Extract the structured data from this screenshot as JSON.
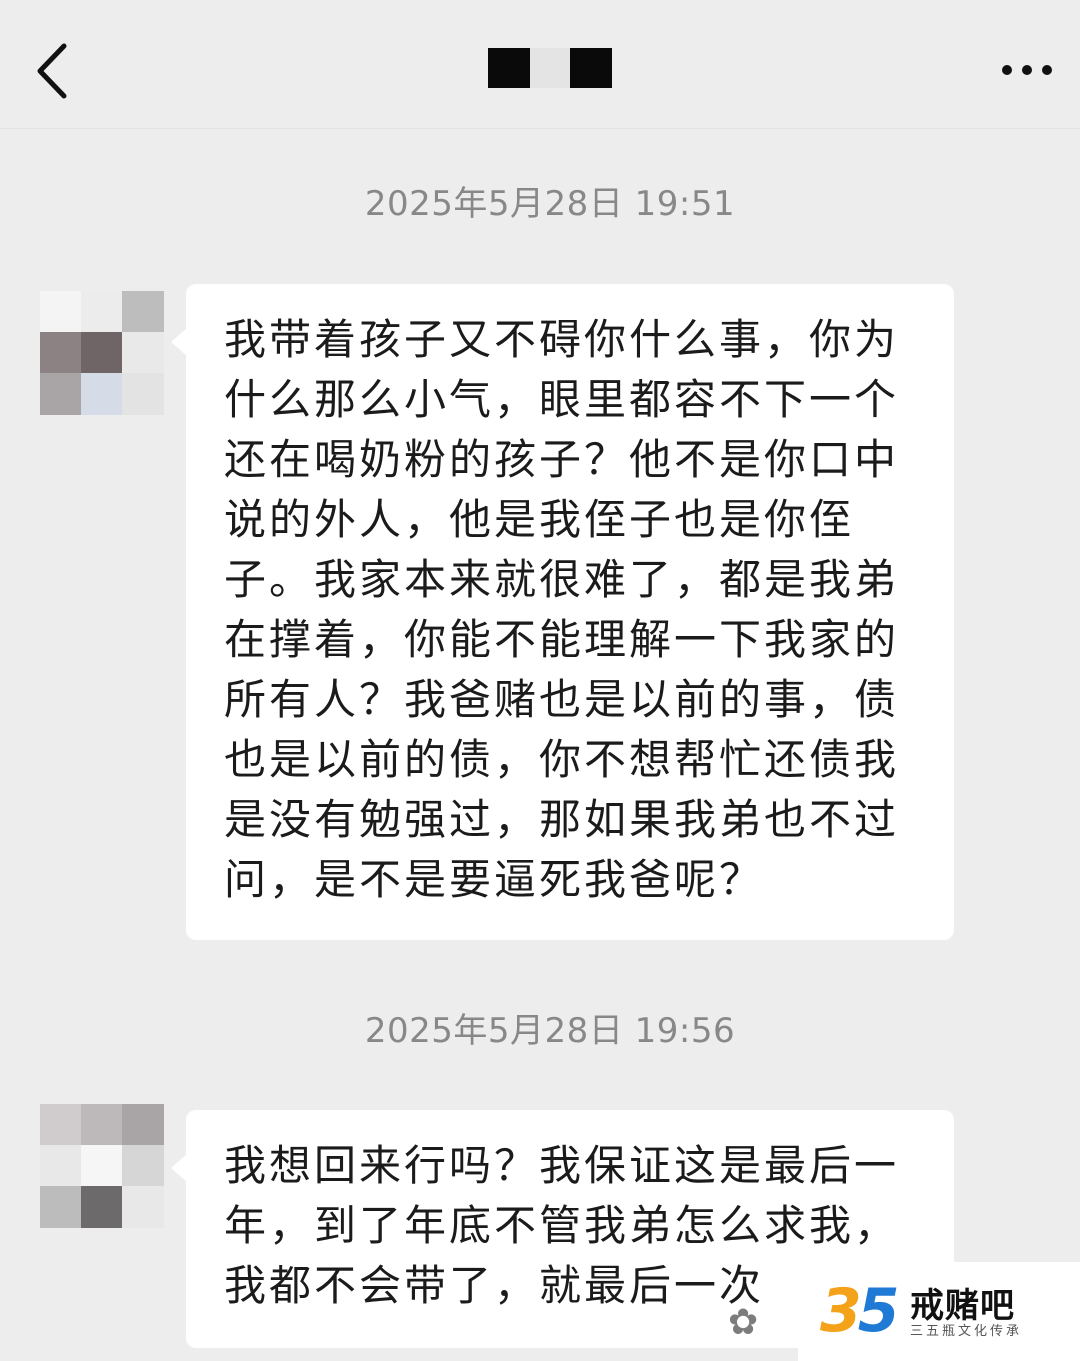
{
  "header": {
    "back_icon": "chevron-left-icon",
    "more_icon": "more-horizontal-icon"
  },
  "messages": [
    {
      "timestamp": "2025年5月28日 19:51",
      "text": "我带着孩子又不碍你什么事，你为什么那么小气，眼里都容不下一个还在喝奶粉的孩子？他不是你口中说的外人，他是我侄子也是你侄子。我家本来就很难了，都是我弟在撑着，你能不能理解一下我家的所有人？我爸赌也是以前的事，债也是以前的债，你不想帮忙还债我是没有勉强过，那如果我弟也不过问，是不是要逼死我爸呢？"
    },
    {
      "timestamp": "2025年5月28日 19:56",
      "text": "我想回来行吗？我保证这是最后一年，到了年底不管我弟怎么求我，我都不会带了，就最后一次"
    }
  ],
  "watermark": {
    "number_a": "3",
    "number_b": "5",
    "name": "戒赌吧",
    "subtitle": "三五瓶文化传承",
    "icon": "wechat-icon",
    "colors": {
      "three": "#f3a21a",
      "five": "#1f7ad6"
    }
  }
}
